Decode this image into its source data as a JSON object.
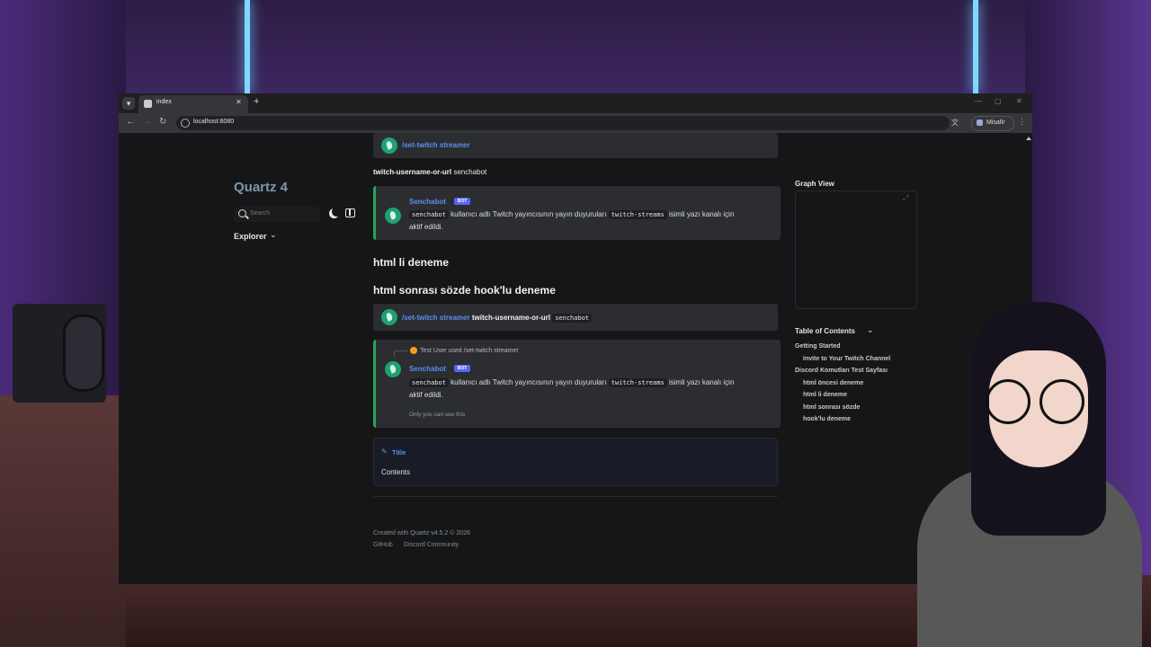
{
  "browser": {
    "tab_title": "index",
    "url": "localhost:8080",
    "profile_label": "Misafir",
    "new_tab_symbol": "+",
    "tab_close_symbol": "✕"
  },
  "site": {
    "title": "Quartz 4",
    "search_placeholder": "Search",
    "explorer_label": "Explorer"
  },
  "content": {
    "top_command": "/set-twitch streamer",
    "param_line_bold": "twitch-username-or-url",
    "param_line_value": "senchabot",
    "msg1": {
      "author": "Senchabot",
      "badge": "BOT",
      "code1": "senchabot",
      "text1": "kullanıcı adlı Twitch yayıncısının yayın duyuruları",
      "code2": "twitch-streams",
      "text2": "isimli yazı kanalı için",
      "text3": "aktif edildi."
    },
    "heading1": "html li deneme",
    "heading2": "html sonrası sözde hook'lu deneme",
    "cmd_card": {
      "command": "/set-twitch streamer",
      "param": "twitch-username-or-url",
      "value": "senchabot"
    },
    "msg2": {
      "reply_text": "Test User used /set-twitch streamer",
      "author": "Senchabot",
      "badge": "BOT",
      "code1": "senchabot",
      "text1": "kullanıcı adlı Twitch yayıncısının yayın duyuruları",
      "code2": "twitch-streams",
      "text2": "isimli yazı kanalı için",
      "text3": "aktif edildi.",
      "ephemeral": "Only you can see this"
    },
    "callout": {
      "title": "Title",
      "body": "Contents"
    }
  },
  "right": {
    "graph_title": "Graph View",
    "toc_title": "Table of Contents",
    "toc": [
      {
        "label": "Getting Started",
        "level": 1
      },
      {
        "label": "Invite to Your Twitch Channel",
        "level": 2
      },
      {
        "label": "Discord Komutları Test Sayfası",
        "level": 1
      },
      {
        "label": "html öncesi deneme",
        "level": 2
      },
      {
        "label": "html li deneme",
        "level": 2
      },
      {
        "label": "html sonrası sözde",
        "level": 2
      },
      {
        "label": "hook'lu deneme",
        "level": 2
      }
    ]
  },
  "footer": {
    "created_prefix": "Created with",
    "quartz_version": "Quartz v4.5.2",
    "year": "© 2026",
    "links": [
      "GitHub",
      "Discord Community"
    ]
  }
}
